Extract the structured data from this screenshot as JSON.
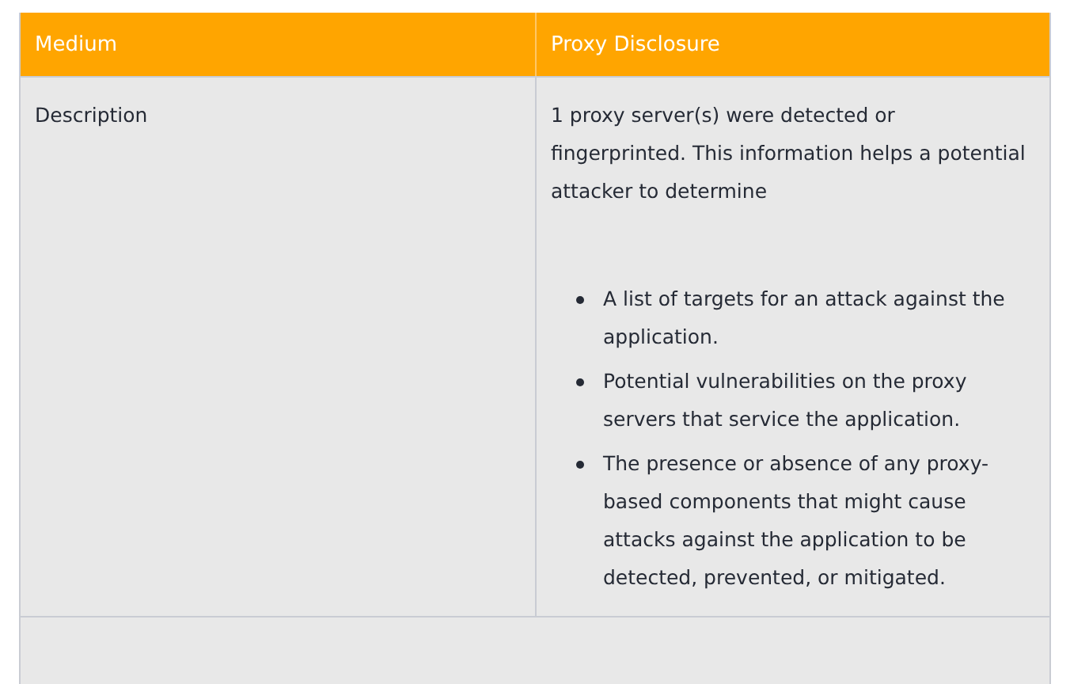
{
  "table": {
    "header": [
      "Medium",
      "Proxy Disclosure"
    ],
    "rows": [
      {
        "label": "Description",
        "paragraph": "1 proxy server(s) were detected or fingerprinted. This information helps a potential attacker to determine",
        "bullets": [
          "A list of targets for an attack against the application.",
          "Potential vulnerabilities on the proxy servers that service the application.",
          "The presence or absence of any proxy-based components that might cause attacks against the application to be detected, prevented, or mitigated."
        ]
      }
    ]
  }
}
